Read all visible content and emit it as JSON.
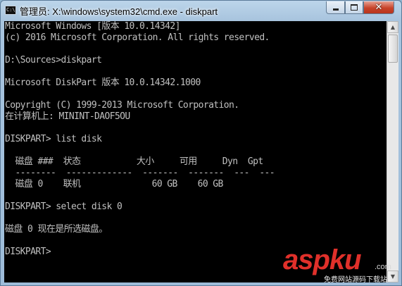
{
  "window": {
    "title": "管理员: X:\\windows\\system32\\cmd.exe - diskpart",
    "app_icon_text": "C:\\",
    "minimize_icon": "minimize-icon",
    "maximize_icon": "maximize-icon",
    "close_icon": "close-icon",
    "close_glyph": "✕"
  },
  "console": {
    "text_color": "#c0c0c0",
    "background": "#000000",
    "lines": [
      "Microsoft Windows [版本 10.0.14342]",
      "(c) 2016 Microsoft Corporation. All rights reserved.",
      "",
      "D:\\Sources>diskpart",
      "",
      "Microsoft DiskPart 版本 10.0.14342.1000",
      "",
      "Copyright (C) 1999-2013 Microsoft Corporation.",
      "在计算机上: MININT-DAOF5OU",
      "",
      "DISKPART> list disk",
      "",
      "  磁盘 ###  状态           大小     可用     Dyn  Gpt",
      "  --------  -------------  -------  -------  ---  ---",
      "  磁盘 0    联机              60 GB    60 GB",
      "",
      "DISKPART> select disk 0",
      "",
      "磁盘 0 现在是所选磁盘。",
      "",
      "DISKPART>"
    ]
  },
  "scrollbar": {
    "up_arrow": "▲",
    "down_arrow": "▼"
  },
  "watermark": {
    "brand_part1": "aspku",
    "brand_part2": "",
    "tld": ".com",
    "slogan": "免费网站源码下载站!"
  }
}
